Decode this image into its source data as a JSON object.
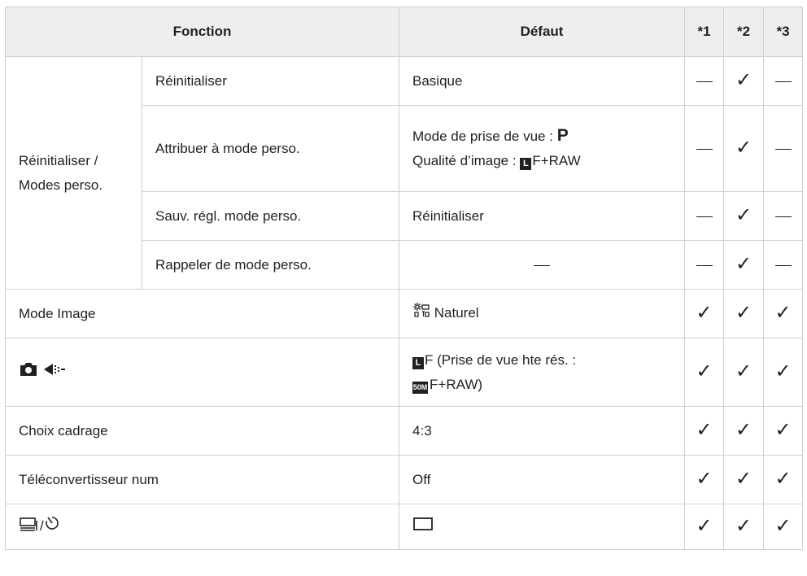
{
  "header": {
    "fonction": "Fonction",
    "defaut": "Défaut",
    "c1": "*1",
    "c2": "*2",
    "c3": "*3"
  },
  "group_label": "Réinitialiser / Modes perso.",
  "rows": [
    {
      "sub": "Réinitialiser",
      "defaut": "Basique",
      "flags": [
        "—",
        "✓",
        "—"
      ]
    },
    {
      "sub": "Attribuer à mode perso.",
      "defaut_line1_text": "Mode de prise de vue : ",
      "defaut_line1_symbol": "P",
      "defaut_line2_text": "Qualité d’image : ",
      "defaut_line2_symbol": "L",
      "defaut_line2_rest": "F+RAW",
      "flags": [
        "—",
        "✓",
        "—"
      ]
    },
    {
      "sub": "Sauv. régl. mode perso.",
      "defaut": "Réinitialiser",
      "flags": [
        "—",
        "✓",
        "—"
      ]
    },
    {
      "sub": "Rappeler de mode perso.",
      "defaut": "—",
      "flags": [
        "—",
        "✓",
        "—"
      ]
    },
    {
      "fonction": "Mode Image",
      "defaut_icon": "natural-picture-mode-icon",
      "defaut": "Naturel",
      "flags": [
        "✓",
        "✓",
        "✓"
      ]
    },
    {
      "fonction_icons": [
        "camera-icon",
        "image-quality-icon"
      ],
      "defaut_symbol": "L",
      "defaut_line1": "F (Prise de vue hte rés. :",
      "defaut_symbol2": "50M",
      "defaut_line2": "F+RAW)",
      "flags": [
        "✓",
        "✓",
        "✓"
      ]
    },
    {
      "fonction": "Choix cadrage",
      "defaut": "4:3",
      "flags": [
        "✓",
        "✓",
        "✓"
      ]
    },
    {
      "fonction": "Téléconvertisseur num",
      "defaut": "Off",
      "flags": [
        "✓",
        "✓",
        "✓"
      ]
    },
    {
      "fonction_icons": [
        "sequential-shooting-icon",
        "self-timer-icon"
      ],
      "fonction_sep": "/",
      "defaut_icon": "single-frame-icon",
      "flags": [
        "✓",
        "✓",
        "✓"
      ]
    }
  ]
}
